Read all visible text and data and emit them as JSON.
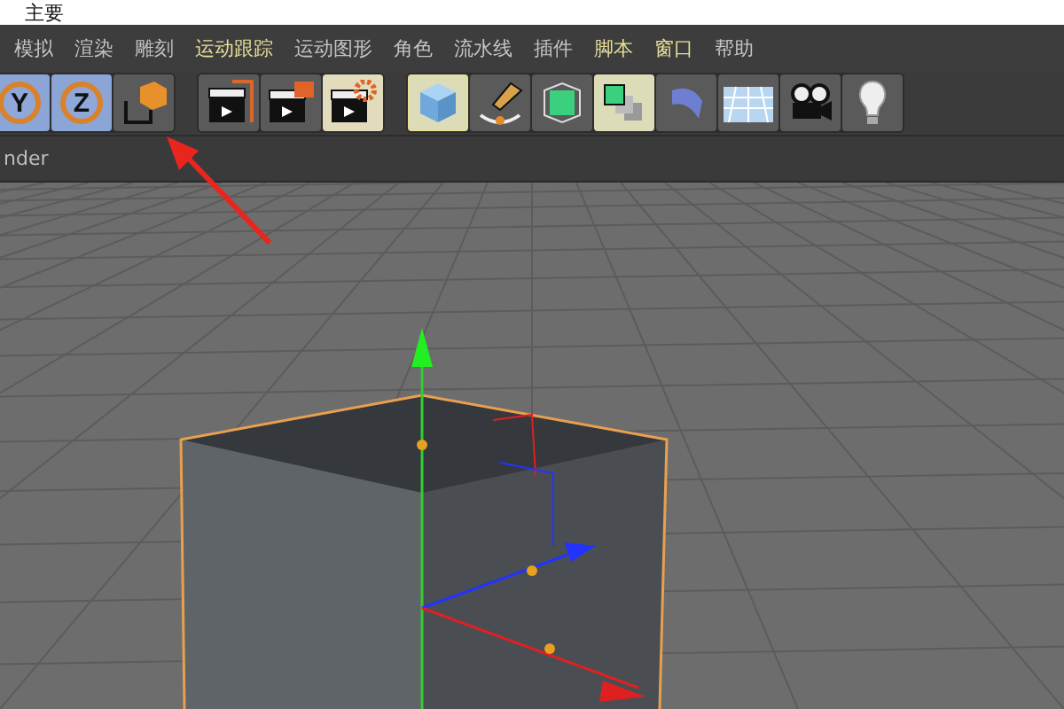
{
  "window": {
    "title": "主要"
  },
  "menu": [
    {
      "label": "模拟",
      "highlighted": false
    },
    {
      "label": "渲染",
      "highlighted": false
    },
    {
      "label": "雕刻",
      "highlighted": false
    },
    {
      "label": "运动跟踪",
      "highlighted": true
    },
    {
      "label": "运动图形",
      "highlighted": false
    },
    {
      "label": "角色",
      "highlighted": false
    },
    {
      "label": "流水线",
      "highlighted": false
    },
    {
      "label": "插件",
      "highlighted": false
    },
    {
      "label": "脚本",
      "highlighted": true
    },
    {
      "label": "窗口",
      "highlighted": true
    },
    {
      "label": "帮助",
      "highlighted": false
    }
  ],
  "toolbar": [
    [
      {
        "kind": "letter",
        "label": "Y",
        "selected": true
      },
      {
        "kind": "letter",
        "label": "Z",
        "selected": true
      },
      {
        "kind": "icon",
        "selected": false
      }
    ],
    [
      {
        "kind": "icon",
        "selected": false
      },
      {
        "kind": "icon",
        "selected": false
      },
      {
        "kind": "icon",
        "selected": true
      }
    ],
    [
      {
        "kind": "icon",
        "selected": true
      },
      {
        "kind": "icon",
        "selected": false
      },
      {
        "kind": "icon",
        "selected": false
      },
      {
        "kind": "icon",
        "selected": true
      },
      {
        "kind": "icon",
        "selected": false
      },
      {
        "kind": "icon",
        "selected": false
      },
      {
        "kind": "icon",
        "selected": false
      },
      {
        "kind": "icon",
        "selected": false
      }
    ]
  ],
  "viewport": {
    "tab": "nder"
  }
}
